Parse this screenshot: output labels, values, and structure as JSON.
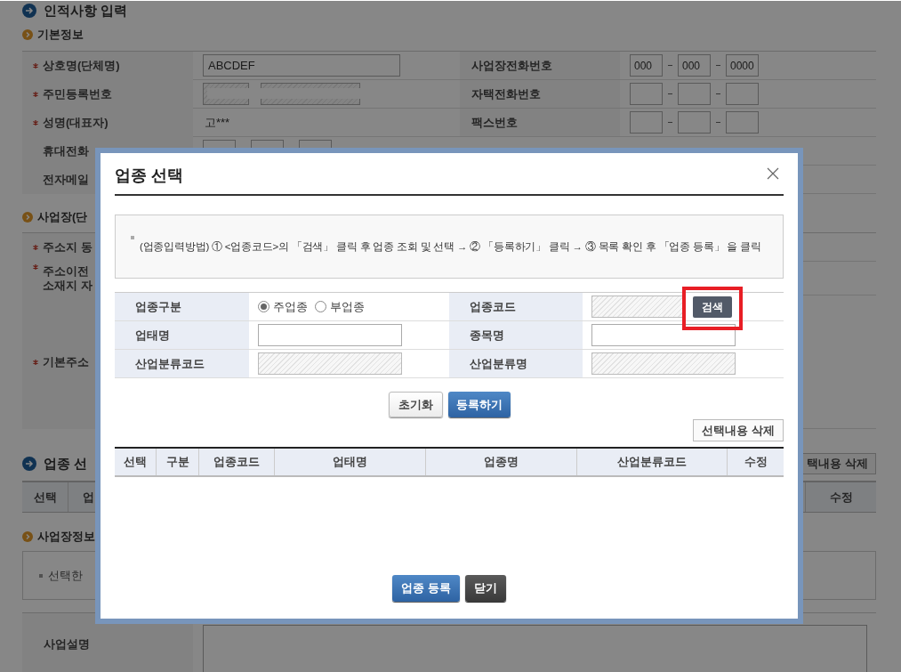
{
  "page": {
    "title": "인적사항 입력",
    "basic_info": {
      "heading": "기본정보",
      "rows": [
        {
          "label": "상호명(단체명)",
          "required": true,
          "field": {
            "kind": "text",
            "value": "ABCDEF"
          },
          "right_label": "사업장전화번호",
          "right_field": {
            "kind": "phone",
            "values": [
              "000",
              "000",
              "0000"
            ]
          }
        },
        {
          "label": "주민등록번호",
          "required": true,
          "field": {
            "kind": "id_number"
          },
          "right_label": "자택전화번호",
          "right_field": {
            "kind": "phone"
          }
        },
        {
          "label": "성명(대표자)",
          "required": true,
          "field": {
            "kind": "plain",
            "value": "고***"
          },
          "right_label": "팩스번호",
          "right_field": {
            "kind": "phone"
          }
        },
        {
          "label": "휴대전화",
          "required": false,
          "field": {
            "kind": "phone"
          }
        },
        {
          "label": "전자메일",
          "required": false
        }
      ]
    },
    "workplace": {
      "heading": "사업장(단",
      "rows": [
        {
          "kind": "single",
          "label": "주소지 동",
          "required": true
        },
        {
          "kind": "double",
          "lines": [
            "주소이전",
            "소재지 자"
          ],
          "required": true
        },
        {
          "kind": "address",
          "label": "기본주소",
          "required": true
        }
      ]
    },
    "industry": {
      "heading": "업종 선",
      "delete_button": "택내용 삭제",
      "columns": [
        "선택",
        "업"
      ],
      "last_column": "수정"
    },
    "business_info": {
      "heading": "사업장정보",
      "note": "선택한",
      "description_label": "사업설명"
    }
  },
  "dialog": {
    "title": "업종 선택",
    "instruction": "(업종입력방법) ① <업종코드>의 「검색」 클릭 후 업종 조회 및 선택 → ② 「등록하기」 클릭 → ③ 목록 확인 후 「업종 등록」 을 클릭",
    "form_rows": [
      {
        "label": "업종구분",
        "field": {
          "kind": "radio",
          "options": [
            {
              "label": "주업종",
              "selected": true
            },
            {
              "label": "부업종",
              "selected": false
            }
          ]
        },
        "label2": "업종코드",
        "field2": {
          "kind": "search",
          "button": "검색",
          "highlighted": true
        }
      },
      {
        "label": "업태명",
        "field": {
          "kind": "text"
        },
        "label2": "종목명",
        "field2": {
          "kind": "text"
        }
      },
      {
        "label": "산업분류코드",
        "field": {
          "kind": "readonly"
        },
        "label2": "산업분류명",
        "field2": {
          "kind": "readonly"
        }
      }
    ],
    "reset_button": "초기화",
    "add_button": "등록하기",
    "delete_button": "선택내용 삭제",
    "columns": [
      "선택",
      "구분",
      "업종코드",
      "업태명",
      "업종명",
      "산업분류코드",
      "수정"
    ],
    "register_button": "업종 등록",
    "close_button": "닫기"
  }
}
